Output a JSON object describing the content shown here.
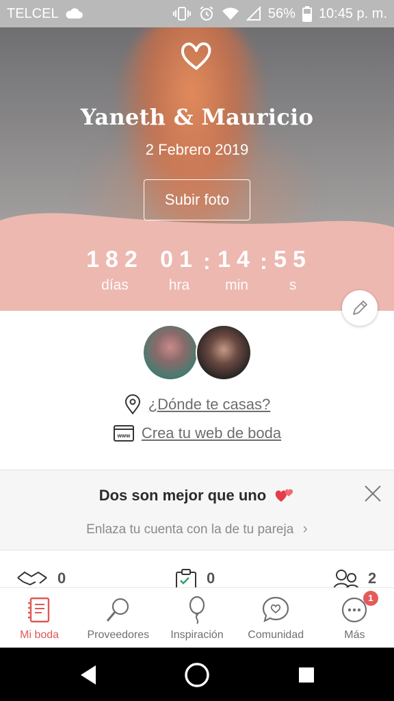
{
  "status_bar": {
    "carrier": "TELCEL",
    "battery": "56%",
    "time": "10:45 p. m."
  },
  "hero": {
    "couple_name": "Yaneth & Mauricio",
    "wedding_date": "2 Febrero 2019",
    "upload_button": "Subir foto",
    "countdown": {
      "days": "182",
      "days_label": "días",
      "hours": "01",
      "hours_label": "hra",
      "minutes": "14",
      "minutes_label": "min",
      "seconds": "55",
      "seconds_label": "s",
      "separator": ":"
    },
    "colors": {
      "wave": "#ecb8b0",
      "text": "#ffffff"
    }
  },
  "profile": {
    "where_link": "¿Dónde te casas?",
    "web_link": "Crea tu web de boda"
  },
  "partner_card": {
    "title": "Dos son mejor que uno",
    "subtitle": "Enlaza tu cuenta con la de tu pareja",
    "chevron": "›"
  },
  "stats": [
    {
      "icon": "handshake-icon",
      "value": "0"
    },
    {
      "icon": "clipboard-icon",
      "value": "0"
    },
    {
      "icon": "guests-icon",
      "value": "2"
    }
  ],
  "bottom_nav": {
    "items": [
      {
        "label": "Mi boda",
        "icon": "notebook-icon",
        "active": true
      },
      {
        "label": "Proveedores",
        "icon": "magnifier-icon",
        "active": false
      },
      {
        "label": "Inspiración",
        "icon": "balloon-icon",
        "active": false
      },
      {
        "label": "Comunidad",
        "icon": "chat-heart-icon",
        "active": false
      },
      {
        "label": "Más",
        "icon": "more-icon",
        "active": false,
        "badge": "1"
      }
    ],
    "colors": {
      "active": "#e05757",
      "inactive": "#6f6f6f"
    }
  }
}
